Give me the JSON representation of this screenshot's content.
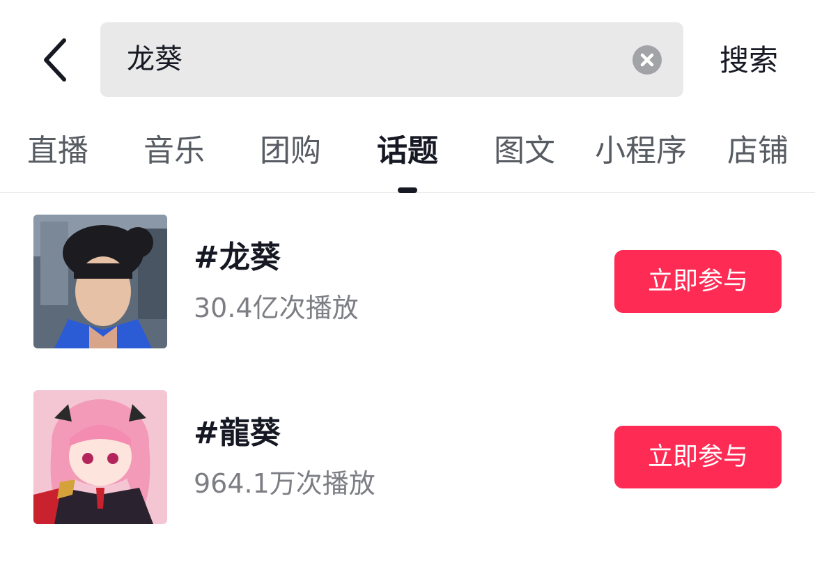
{
  "search": {
    "query": "龙葵",
    "submit_label": "搜索"
  },
  "tabs": [
    {
      "label": "直播"
    },
    {
      "label": "音乐"
    },
    {
      "label": "团购"
    },
    {
      "label": "话题",
      "active": true
    },
    {
      "label": "图文"
    },
    {
      "label": "小程序"
    },
    {
      "label": "店铺"
    }
  ],
  "topics": [
    {
      "title": "#龙葵",
      "plays": "30.4亿次播放",
      "action_label": "立即参与"
    },
    {
      "title": "#龍葵",
      "plays": "964.1万次播放",
      "action_label": "立即参与"
    }
  ],
  "colors": {
    "accent": "#fe2c55",
    "search_bg": "#e9e9ea",
    "primary_text": "#161823",
    "secondary_text": "#7c7e84"
  }
}
